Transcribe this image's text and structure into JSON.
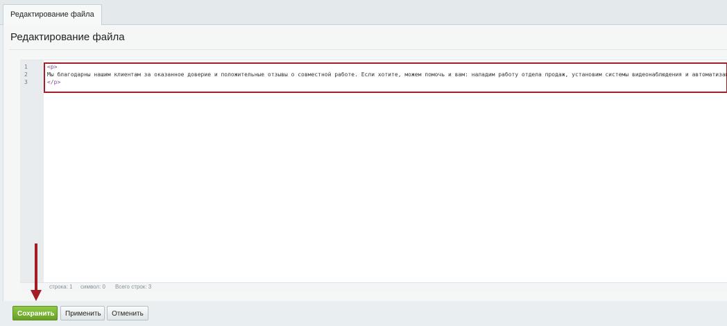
{
  "tab": {
    "label": "Редактирование файла"
  },
  "page": {
    "title": "Редактирование файла"
  },
  "editor": {
    "line_numbers": [
      "1",
      "2",
      "3"
    ],
    "lines": [
      "<p>",
      "Мы благодарны нашим клиентам за оказанное доверие и положительные отзывы о совместной работе. Если хотите, можем помочь и вам: наладим работу отдела продаж, установим системы видеонаблюдения и автоматизации",
      "</p>"
    ],
    "status": {
      "line": "строка: 1",
      "symbol": "символ: 0",
      "total": "Всего строк: 3"
    }
  },
  "buttons": {
    "save": "Сохранить",
    "apply": "Применить",
    "cancel": "Отменить"
  },
  "colors": {
    "accent_green": "#679f22",
    "highlight_red": "#a31d24"
  }
}
